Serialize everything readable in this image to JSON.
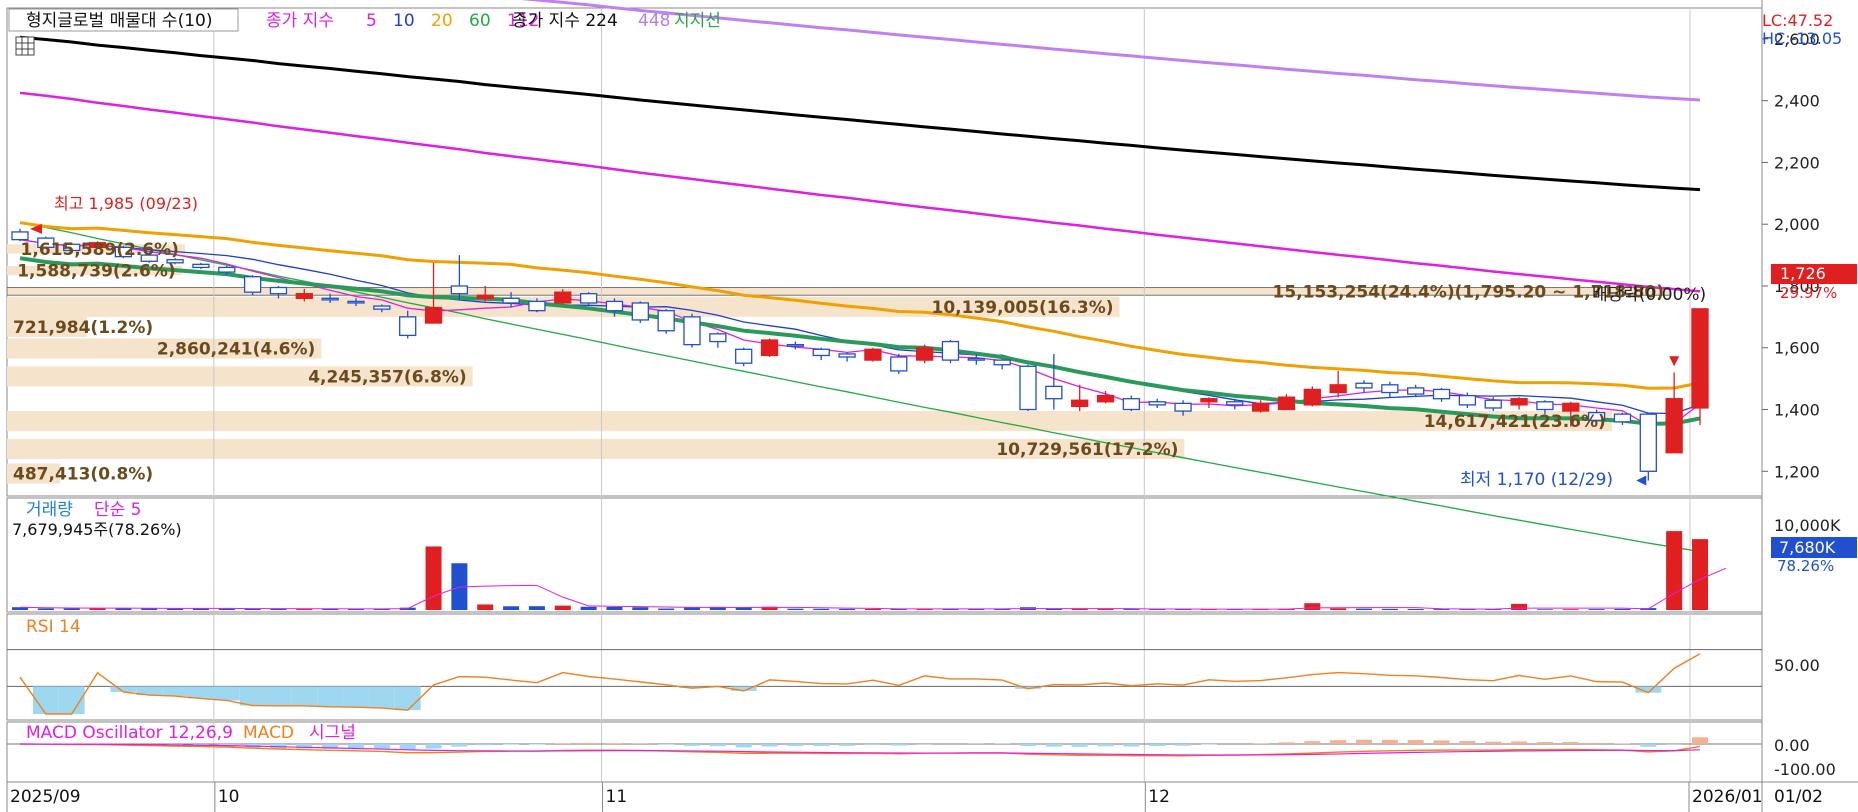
{
  "price_legend": {
    "title": "형지글로벌 매물대 수(10)",
    "ma_label": "종가 지수",
    "ma_periods": [
      {
        "label": "5",
        "color": "#e020e0"
      },
      {
        "label": "10",
        "color": "#1f3fcf"
      },
      {
        "label": "20",
        "color": "#f0a000"
      },
      {
        "label": "60",
        "color": "#22aa44"
      },
      {
        "label": "112",
        "color": "#e020e0"
      }
    ],
    "ma2_label": "종가 지수 224",
    "ma3_label": "448",
    "support_label": "지지선"
  },
  "right_info": {
    "lc": "LC:47.52",
    "hc": "HC:-13.05",
    "price_tag": "1,726",
    "price_pct": "29.97%"
  },
  "annotations": {
    "high": "최고 1,985 (09/23)",
    "low": "최저 1,170 (12/29)",
    "dividend": "배당락(0.00%)"
  },
  "volume_profile": [
    {
      "price_lo": 1905,
      "price_hi": 1935,
      "volume_label": "1,615,589(2.6%)",
      "frac": 0.107
    },
    {
      "price_lo": 1835,
      "price_hi": 1865,
      "volume_label": "1,588,739(2.6%)",
      "frac": 0.105
    },
    {
      "price_lo": 1770,
      "price_hi": 1795,
      "volume_label": "15,153,254(24.4%)(1,795.20 ~ 1,718.80)",
      "frac": 1.0,
      "highlight": true
    },
    {
      "price_lo": 1700,
      "price_hi": 1765,
      "volume_label": "10,139,005(16.3%)",
      "frac": 0.669
    },
    {
      "price_lo": 1635,
      "price_hi": 1700,
      "volume_label": "721,984(1.2%)",
      "frac": 0.048
    },
    {
      "price_lo": 1565,
      "price_hi": 1630,
      "volume_label": "2,860,241(4.6%)",
      "frac": 0.189
    },
    {
      "price_lo": 1475,
      "price_hi": 1540,
      "volume_label": "4,245,357(6.8%)",
      "frac": 0.28
    },
    {
      "price_lo": 1330,
      "price_hi": 1395,
      "volume_label": "14,617,421(23.6%)",
      "frac": 0.965
    },
    {
      "price_lo": 1240,
      "price_hi": 1305,
      "volume_label": "10,729,561(17.2%)",
      "frac": 0.708
    },
    {
      "price_lo": 1160,
      "price_hi": 1225,
      "volume_label": "487,413(0.8%)",
      "frac": 0.032
    }
  ],
  "volume_panel": {
    "title": "거래량",
    "ma_label": "단순 5",
    "stat": "7,679,945주(78.26%)",
    "tag": "7,680K",
    "tag_pct": "78.26%"
  },
  "rsi_panel": {
    "title": "RSI 14"
  },
  "macd_panel": {
    "title": "MACD Oscillator 12,26,9",
    "macd_label": "MACD",
    "signal_label": "시그널"
  },
  "colors": {
    "up": "#e02020",
    "down": "#2050d0",
    "volume_profile": "#f5e3cc",
    "grid": "#c8c8c8"
  },
  "chart_data": {
    "type": "candlestick",
    "dates": [
      "09/23",
      "09/24",
      "09/25",
      "09/26",
      "09/29",
      "09/30",
      "10/01",
      "10/02",
      "10/10",
      "10/13",
      "10/14",
      "10/15",
      "10/16",
      "10/17",
      "10/20",
      "10/21",
      "10/22",
      "10/23",
      "10/24",
      "10/27",
      "10/28",
      "10/29",
      "10/30",
      "10/31",
      "11/03",
      "11/04",
      "11/05",
      "11/06",
      "11/07",
      "11/10",
      "11/11",
      "11/12",
      "11/13",
      "11/14",
      "11/17",
      "11/18",
      "11/19",
      "11/20",
      "11/21",
      "11/24",
      "11/25",
      "11/26",
      "11/27",
      "11/28",
      "12/01",
      "12/02",
      "12/03",
      "12/04",
      "12/05",
      "12/08",
      "12/09",
      "12/10",
      "12/11",
      "12/12",
      "12/15",
      "12/16",
      "12/17",
      "12/18",
      "12/19",
      "12/22",
      "12/23",
      "12/24",
      "12/26",
      "12/29",
      "12/30",
      "01/02"
    ],
    "open": [
      1975,
      1955,
      1935,
      1925,
      1925,
      1900,
      1885,
      1870,
      1860,
      1830,
      1795,
      1760,
      1760,
      1750,
      1735,
      1700,
      1680,
      1800,
      1760,
      1760,
      1750,
      1745,
      1775,
      1750,
      1745,
      1720,
      1700,
      1645,
      1595,
      1575,
      1610,
      1595,
      1580,
      1560,
      1570,
      1560,
      1620,
      1565,
      1560,
      1540,
      1475,
      1410,
      1425,
      1435,
      1425,
      1420,
      1425,
      1425,
      1395,
      1400,
      1415,
      1455,
      1485,
      1480,
      1470,
      1465,
      1445,
      1430,
      1415,
      1425,
      1395,
      1390,
      1385,
      1385,
      1260,
      1405
    ],
    "close": [
      1950,
      1925,
      1915,
      1940,
      1895,
      1880,
      1875,
      1860,
      1845,
      1780,
      1775,
      1775,
      1755,
      1745,
      1725,
      1640,
      1730,
      1775,
      1770,
      1745,
      1720,
      1780,
      1745,
      1720,
      1690,
      1655,
      1610,
      1620,
      1550,
      1625,
      1605,
      1575,
      1570,
      1595,
      1525,
      1600,
      1560,
      1560,
      1545,
      1400,
      1435,
      1430,
      1445,
      1400,
      1415,
      1395,
      1435,
      1415,
      1420,
      1440,
      1465,
      1480,
      1470,
      1455,
      1450,
      1435,
      1415,
      1405,
      1435,
      1400,
      1420,
      1365,
      1360,
      1200,
      1435,
      1726
    ],
    "high": [
      1985,
      1960,
      1940,
      1945,
      1930,
      1905,
      1890,
      1875,
      1865,
      1835,
      1800,
      1790,
      1775,
      1760,
      1740,
      1720,
      1875,
      1900,
      1800,
      1780,
      1760,
      1790,
      1780,
      1760,
      1750,
      1725,
      1710,
      1650,
      1600,
      1630,
      1620,
      1600,
      1585,
      1600,
      1580,
      1610,
      1625,
      1580,
      1565,
      1545,
      1580,
      1480,
      1460,
      1445,
      1435,
      1430,
      1440,
      1435,
      1430,
      1450,
      1475,
      1525,
      1495,
      1490,
      1480,
      1470,
      1455,
      1440,
      1440,
      1430,
      1425,
      1400,
      1390,
      1390,
      1520,
      1726
    ],
    "low": [
      1945,
      1920,
      1910,
      1920,
      1890,
      1875,
      1870,
      1855,
      1835,
      1770,
      1760,
      1750,
      1745,
      1735,
      1715,
      1630,
      1680,
      1755,
      1750,
      1730,
      1715,
      1740,
      1740,
      1700,
      1680,
      1645,
      1600,
      1600,
      1540,
      1570,
      1595,
      1560,
      1555,
      1555,
      1515,
      1550,
      1550,
      1545,
      1530,
      1395,
      1400,
      1395,
      1420,
      1395,
      1405,
      1380,
      1405,
      1400,
      1390,
      1400,
      1410,
      1440,
      1455,
      1440,
      1440,
      1425,
      1405,
      1395,
      1400,
      1385,
      1345,
      1350,
      1350,
      1170,
      1260,
      1350
    ],
    "volume": [
      380,
      220,
      210,
      240,
      260,
      230,
      200,
      210,
      180,
      160,
      170,
      150,
      160,
      150,
      160,
      320,
      8700,
      6400,
      760,
      510,
      520,
      600,
      440,
      410,
      380,
      200,
      360,
      420,
      350,
      450,
      180,
      160,
      150,
      140,
      160,
      170,
      150,
      160,
      140,
      380,
      140,
      160,
      130,
      120,
      110,
      130,
      110,
      100,
      130,
      160,
      930,
      230,
      180,
      150,
      140,
      120,
      110,
      100,
      840,
      100,
      110,
      120,
      150,
      260,
      10800,
      9700,
      7680
    ],
    "ma224": [
      2605,
      2598,
      2590,
      2580,
      2572,
      2563,
      2555,
      2546,
      2538,
      2530,
      2520,
      2512,
      2504,
      2495,
      2487,
      2478,
      2470,
      2462,
      2452,
      2444,
      2436,
      2428,
      2420,
      2411,
      2402,
      2394,
      2386,
      2378,
      2370,
      2362,
      2354,
      2346,
      2339,
      2331,
      2323,
      2315,
      2308,
      2300,
      2292,
      2285,
      2277,
      2270,
      2262,
      2255,
      2247,
      2240,
      2233,
      2226,
      2219,
      2212,
      2205,
      2198,
      2192,
      2185,
      2178,
      2172,
      2165,
      2158,
      2152,
      2146,
      2140,
      2134,
      2128,
      2122,
      2117,
      2112
    ],
    "ylim": [
      1120,
      2700
    ],
    "x_labels": [
      "2025/09",
      "10",
      "11",
      "12",
      "2026/01"
    ],
    "y_ticks": [
      1200,
      1400,
      1600,
      1800,
      2000,
      2200,
      2400,
      2600
    ],
    "volume_ticks": [
      "10,000K"
    ],
    "rsi_ticks": [
      "50.00"
    ],
    "macd_ticks": [
      "0.00",
      "-100.00"
    ],
    "right_date": "01/02"
  }
}
